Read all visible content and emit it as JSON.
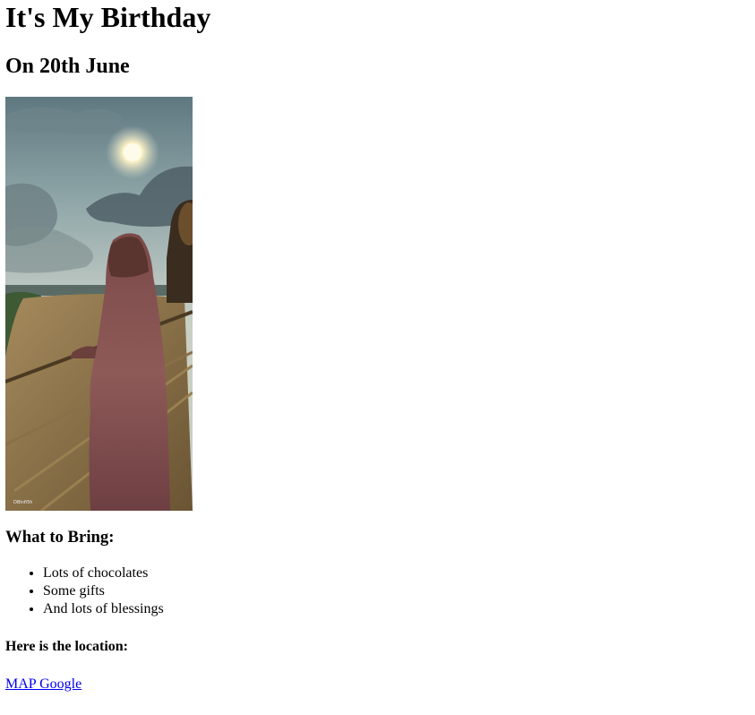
{
  "page": {
    "title": "It's My Birthday",
    "subtitle": "On 20th June",
    "photo_credit": "DBInfi5h",
    "bring_heading": "What to Bring:",
    "bring_items": [
      "Lots of chocolates",
      "Some gifts",
      "And lots of blessings"
    ],
    "location_heading": "Here is the location:",
    "map_link_label": "MAP Google"
  },
  "colors": {
    "link": "#0000ee",
    "text": "#000000",
    "background": "#ffffff"
  }
}
